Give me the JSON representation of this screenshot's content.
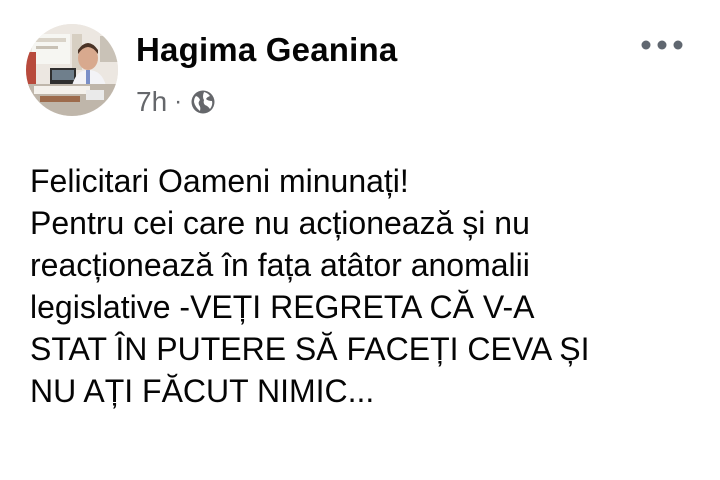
{
  "post": {
    "author": {
      "name": "Hagima Geanina",
      "avatar_icon": "profile-photo"
    },
    "meta": {
      "time": "7h",
      "separator": "·",
      "privacy_icon": "globe-icon"
    },
    "more_icon": "ellipsis-icon",
    "text_lines": [
      "Felicitari Oameni minunați!",
      "Pentru cei care nu acționează și nu",
      "reacționează în fața atâtor anomalii",
      "legislative -VEȚI REGRETA CĂ V-A",
      "STAT ÎN PUTERE SĂ FACEȚI CEVA ȘI",
      "NU AȚI FĂCUT NIMIC..."
    ]
  },
  "colors": {
    "text_primary": "#050505",
    "text_secondary": "#65676b",
    "background": "#ffffff"
  }
}
